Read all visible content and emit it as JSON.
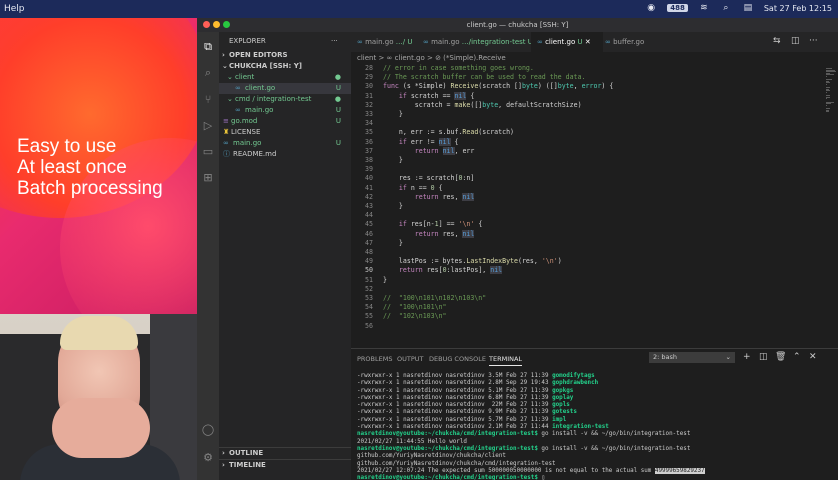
{
  "menubar": {
    "app_menu": "Help",
    "badge": "488",
    "datetime": "Sat 27 Feb 12:15"
  },
  "slide": {
    "lines": [
      "Easy to use",
      "At least once",
      "Batch processing"
    ]
  },
  "window": {
    "title": "client.go — chukcha [SSH: Y]"
  },
  "explorer": {
    "header": "EXPLORER",
    "more": "···",
    "open_editors": "OPEN EDITORS",
    "workspace": "CHUKCHA [SSH: Y]",
    "items": [
      {
        "label": "client",
        "status": "●",
        "kind": "folder"
      },
      {
        "label": "client.go",
        "status": "U",
        "kind": "go"
      },
      {
        "label": "cmd / integration-test",
        "status": "●",
        "kind": "folder"
      },
      {
        "label": "main.go",
        "status": "U",
        "kind": "go"
      },
      {
        "label": "go.mod",
        "status": "U",
        "kind": "mod"
      },
      {
        "label": "LICENSE",
        "status": "",
        "kind": "license"
      },
      {
        "label": "main.go",
        "status": "U",
        "kind": "go"
      },
      {
        "label": "README.md",
        "status": "",
        "kind": "md"
      }
    ],
    "outline": "OUTLINE",
    "timeline": "TIMELINE"
  },
  "tabs": [
    {
      "label": "main.go",
      "suffix": "…/ U",
      "active": false
    },
    {
      "label": "main.go",
      "suffix": "…/integration-test U",
      "active": false
    },
    {
      "label": "client.go",
      "suffix": "U",
      "active": true
    },
    {
      "label": "buffer.go",
      "suffix": "",
      "active": false
    }
  ],
  "breadcrumb": "client  >  ∞ client.go  >  ⊘ (*Simple).Receive",
  "code": {
    "line_numbers": [
      "28",
      "29",
      "30",
      "31",
      "32",
      "33",
      "34",
      "35",
      "36",
      "37",
      "38",
      "39",
      "40",
      "41",
      "42",
      "43",
      "44",
      "45",
      "46",
      "47",
      "48",
      "49",
      "50",
      "51",
      "52",
      "53",
      "54",
      "55",
      "56"
    ],
    "current_line": "50",
    "lines": [
      "// error in case something goes wrong.",
      "// The scratch buffer can be used to read the data.",
      "func (s *Simple) Receive(scratch []byte) ([]byte, error) {",
      "    if scratch == nil {",
      "        scratch = make([]byte, defaultScratchSize)",
      "    }",
      "",
      "    n, err := s.buf.Read(scratch)",
      "    if err != nil {",
      "        return nil, err",
      "    }",
      "",
      "    res := scratch[0:n]",
      "    if n == 0 {",
      "        return res, nil",
      "    }",
      "",
      "    if res[n-1] == '\\n' {",
      "        return res, nil",
      "    }",
      "",
      "    lastPos := bytes.LastIndexByte(res, '\\n')",
      "    return res[0:lastPos], nil",
      "}",
      "",
      "//  \"100\\n101\\n102\\n103\\n\"",
      "//  \"100\\n101\\n\"",
      "//  \"102\\n103\\n\"",
      ""
    ]
  },
  "panel": {
    "tabs": [
      "PROBLEMS",
      "OUTPUT",
      "DEBUG CONSOLE",
      "TERMINAL"
    ],
    "active_tab": "TERMINAL",
    "shell": "2: bash",
    "terminal": [
      {
        "pre": "-rwxrwxr-x 1 nasretdinov nasretdinov 3.5M Feb 27 11:39 ",
        "g": "gomodifytags"
      },
      {
        "pre": "-rwxrwxr-x 1 nasretdinov nasretdinov 2.8M Sep 29 19:43 ",
        "g": "gophdrawbench"
      },
      {
        "pre": "-rwxrwxr-x 1 nasretdinov nasretdinov 5.1M Feb 27 11:39 ",
        "g": "gopkgs"
      },
      {
        "pre": "-rwxrwxr-x 1 nasretdinov nasretdinov 6.8M Feb 27 11:39 ",
        "g": "goplay"
      },
      {
        "pre": "-rwxrwxr-x 1 nasretdinov nasretdinov  22M Feb 27 11:39 ",
        "g": "gopls"
      },
      {
        "pre": "-rwxrwxr-x 1 nasretdinov nasretdinov 9.9M Feb 27 11:39 ",
        "g": "gotests"
      },
      {
        "pre": "-rwxrwxr-x 1 nasretdinov nasretdinov 5.7M Feb 27 11:39 ",
        "g": "impl"
      },
      {
        "pre": "-rwxrwxr-x 1 nasretdinov nasretdinov 2.1M Feb 27 11:44 ",
        "g": "integration-test"
      },
      {
        "prompt": "nasretdinov@youtube:~/chukcha/cmd/integration-test$",
        "cmd": " go install -v && ~/go/bin/integration-test"
      },
      {
        "text": "2021/02/27 11:44:55 Hello world"
      },
      {
        "prompt": "nasretdinov@youtube:~/chukcha/cmd/integration-test$",
        "cmd": " go install -v && ~/go/bin/integration-test"
      },
      {
        "text": "github.com/YuriyNasretdinov/chukcha/client"
      },
      {
        "text": "github.com/YuriyNasretdinov/chukcha/cmd/integration-test"
      },
      {
        "text": "2021/02/27 12:07:24 The expected sum 500000050000000 is not equal to the actual sum ",
        "hl": "49999659829237"
      },
      {
        "prompt": "nasretdinov@youtube:~/chukcha/cmd/integration-test$",
        "cmd": " ▯"
      }
    ]
  }
}
